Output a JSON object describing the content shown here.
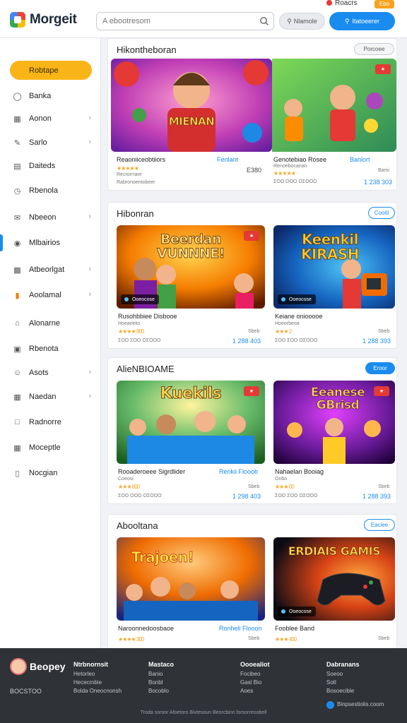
{
  "header": {
    "logo": "Morgeit",
    "search_placeholder": "A ebootresom",
    "grey_button": "Nlamole",
    "blue_button": "Itatoeerer",
    "top_link": "Roacrs",
    "top_badge": "Ebo"
  },
  "sidebar": {
    "primary": "Robtape",
    "items": [
      {
        "label": "Banka",
        "icon": "circle-icon",
        "chevron": false
      },
      {
        "label": "Aonon",
        "icon": "calendar-icon",
        "chevron": true
      },
      {
        "label": "Sarlo",
        "icon": "edit-icon",
        "chevron": true
      },
      {
        "label": "Daiteds",
        "icon": "document-icon",
        "chevron": false
      },
      {
        "label": "Rbenola",
        "icon": "clock-icon",
        "chevron": false
      },
      {
        "label": "Nbeeon",
        "icon": "chat-icon",
        "chevron": true
      },
      {
        "label": "Mlbairios",
        "icon": "gamepad-icon",
        "chevron": false
      },
      {
        "label": "Atbeorlgat",
        "icon": "chart-icon",
        "chevron": true
      },
      {
        "label": "Aoolamal",
        "icon": "bookmark-icon",
        "chevron": true
      },
      {
        "label": "Alonarne",
        "icon": "home-icon",
        "chevron": false
      },
      {
        "label": "Rbenota",
        "icon": "image-icon",
        "chevron": false
      },
      {
        "label": "Asots",
        "icon": "smile-icon",
        "chevron": true
      },
      {
        "label": "Naedan",
        "icon": "grid-icon",
        "chevron": true
      },
      {
        "label": "Radnorre",
        "icon": "folder-icon",
        "chevron": false
      },
      {
        "label": "Moceptle",
        "icon": "table-icon",
        "chevron": false
      },
      {
        "label": "Nocgian",
        "icon": "file-icon",
        "chevron": false
      }
    ]
  },
  "sections": [
    {
      "title": "Hikontheboran",
      "pill": "Porcoee",
      "cards": [
        {
          "art": "MIENAN",
          "title": "Reaoniiceobtiiors",
          "link": "Fenlant",
          "small1": "Recrorrrare",
          "small2": "Rabronoentobeer",
          "price": "Ε380",
          "extra": "",
          "stars": "★★★★★"
        },
        {
          "art": "",
          "title": "Genotebiao Rosee",
          "link": "Banlort",
          "small1": "Renoebocanan",
          "small2": "ΣΟΟ ΟΟΟ ΟΣΟΟΟ",
          "price": "1 238 303",
          "extra": "Barsi",
          "stars": "★★★★★"
        }
      ]
    },
    {
      "title": "Hibonran",
      "pill": "Cooiti",
      "cards": [
        {
          "art": "Beerdan\nVUNNNE!",
          "title": "Rusohbbiee Disbooe",
          "link": "",
          "small1": "Hoearieks",
          "small2": "ΣΟΟ ΣΟΟ ΟΣΟΟΟ",
          "price": "1 288 403",
          "extra": "Sbeb",
          "stars": "★★★★ 800",
          "tag": "Ooeocose"
        },
        {
          "art": "Keenkil\nKIRASH",
          "title": "Keiane oniooooe",
          "link": "",
          "small1": "Hoeorbeoa",
          "small2": "ΣΟΟ ΣΟΟ ΟΣΟΟΟ",
          "price": "1 288 393",
          "extra": "Sbeb",
          "stars": "★★★ 2",
          "tag": "Ooeocose"
        }
      ]
    },
    {
      "title": "AlieNBIOAME",
      "pill": "Eroor",
      "cards": [
        {
          "art": "Kuekils",
          "title": "Rooaderoeee Sigrdlider",
          "link": "Renkii Flooob",
          "small1": "Coeosi",
          "small2": "ΣΟΟ ΟΟΟ ΟΣΟΟΟ",
          "price": "1 298 403",
          "extra": "Sbeb",
          "stars": "★★★ 800"
        },
        {
          "art": "Eeanese\nGBrisd",
          "title": "Nahaelan Booiag",
          "link": "",
          "small1": "Onbo",
          "small2": "ΣΟΟ ΣΟΟ ΟΣΟΟΟ",
          "price": "1 288 393",
          "extra": "Sbeb",
          "stars": "★★★ 00"
        }
      ]
    },
    {
      "title": "Abooltana",
      "pill": "Eaciee",
      "cards": [
        {
          "art": "Trajoen!",
          "title": "Naroonnedoosbaoe",
          "link": "Ronheli Flooon",
          "small1": "",
          "small2": "",
          "price": "",
          "extra": "Sbeb",
          "stars": "★★★★ 300"
        },
        {
          "art": "ERDIAIS GAMIS",
          "title": "Fooblee Band",
          "link": "",
          "small1": "",
          "small2": "",
          "price": "",
          "extra": "Sbeb",
          "stars": "★★★ 400"
        }
      ]
    }
  ],
  "footer": {
    "brand": "Beopey",
    "sub": "BOCSTOO",
    "columns": [
      {
        "heading": "Ntrbnornsit",
        "links": [
          "Hetorleo",
          "Hececmbie",
          "Bolda Oneocnonsh"
        ]
      },
      {
        "heading": "Mastaco",
        "links": [
          "Banio",
          "Bonbl",
          "Bocoblo"
        ]
      },
      {
        "heading": "Oooealiot",
        "links": [
          "Focibeo",
          "Gasl Bio",
          "Aoes"
        ]
      },
      {
        "heading": "Dabranans",
        "links": [
          "Soeoo",
          "Sotl",
          "Bosoecible"
        ]
      }
    ],
    "email": "Binpsestiolis.coom",
    "copyright": "Troda soroor Afoetoro Bivtesoun Beorcbinn forsorreoobell"
  }
}
